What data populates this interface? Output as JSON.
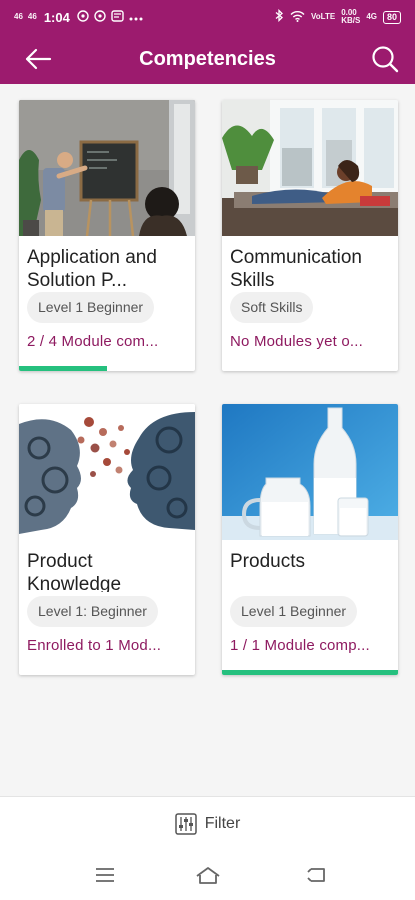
{
  "status_bar": {
    "signal_1": "46",
    "signal_2": "46",
    "time": "1:04",
    "network_speed": "0.00",
    "network_speed_unit": "KB/S",
    "network_type": "4G",
    "battery": "80",
    "icon_names": [
      "signal-icon",
      "signal-icon",
      "whatsapp-icon",
      "whatsapp-icon",
      "message-icon",
      "more-dots-icon",
      "bluetooth-icon",
      "wifi-icon",
      "volte-icon",
      "battery-icon"
    ]
  },
  "app_bar": {
    "title": "Competencies",
    "back_icon": "arrow-left-icon",
    "search_icon": "search-icon",
    "color": "#9c1b6e"
  },
  "cards": [
    {
      "title": "Application and Solution P...",
      "level": "Level 1 Beginner",
      "status": "2 / 4 Module com...",
      "progress": 0.5,
      "image": "classroom-blackboard-photo"
    },
    {
      "title": "Communication Skills",
      "level": "Soft Skills",
      "status": "No Modules yet o...",
      "progress": 0,
      "image": "woman-on-sofa-photo"
    },
    {
      "title": "Product Knowledge",
      "level": "Level 1: Beginner",
      "status": "Enrolled to 1 Mod...",
      "progress": 0,
      "image": "gear-heads-illustration"
    },
    {
      "title": "Products",
      "level": "Level 1 Beginner",
      "status": "1 / 1 Module comp...",
      "progress": 1,
      "image": "milk-bottles-photo"
    }
  ],
  "colors": {
    "accent": "#9c1b6e",
    "status_text": "#8e1a60",
    "progress": "#25c07e"
  },
  "filter": {
    "label": "Filter",
    "icon": "sliders-icon"
  },
  "nav": {
    "icons": [
      "menu-icon",
      "home-icon",
      "back-nav-icon"
    ]
  }
}
